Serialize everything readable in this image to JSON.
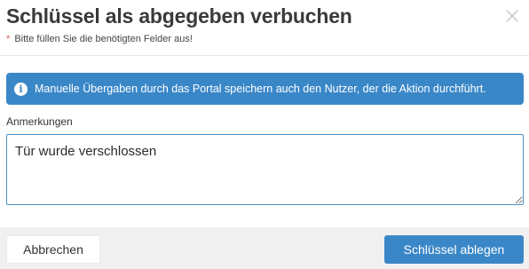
{
  "dialog": {
    "title": "Schlüssel als abgegeben verbuchen",
    "required_star": "*",
    "required_note": "Bitte füllen Sie die benötigten Felder aus!",
    "close_icon": "close-icon"
  },
  "info": {
    "icon": "info-icon",
    "icon_glyph": "i",
    "message": "Manuelle Übergaben durch das Portal speichern auch den Nutzer, der die Aktion durchführt."
  },
  "notes": {
    "label": "Anmerkungen",
    "value": "Tür wurde verschlossen"
  },
  "footer": {
    "cancel_label": "Abbrechen",
    "submit_label": "Schlüssel ablegen"
  },
  "colors": {
    "accent": "#3a87c8",
    "required": "#d9534f",
    "footer_bg": "#f0f0f0"
  }
}
